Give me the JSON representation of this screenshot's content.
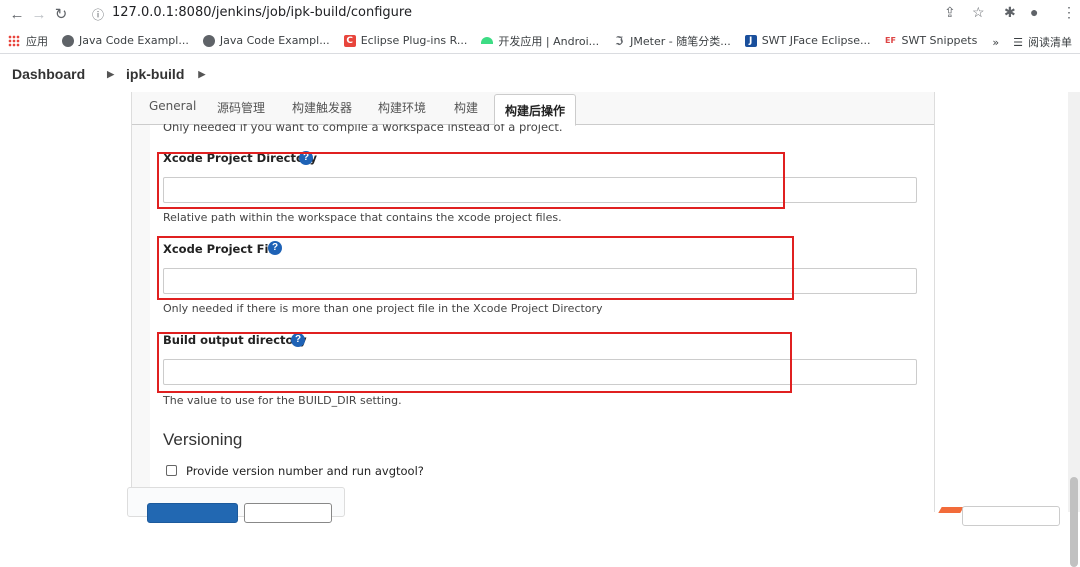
{
  "browser": {
    "url_host": "127.0.0.1",
    "url_path": ":8080/jenkins/job/ipk-build/configure",
    "bookmarks": [
      {
        "label": "应用",
        "icon": "apps-grid-icon",
        "color": "#e8453c"
      },
      {
        "label": "Java Code Exampl...",
        "icon": "globe-icon",
        "color": "#5f6368"
      },
      {
        "label": "Java Code Exampl...",
        "icon": "globe-icon",
        "color": "#5f6368"
      },
      {
        "label": "Eclipse Plug-ins R...",
        "icon": "c-logo-icon",
        "color": "#e8453c"
      },
      {
        "label": "开发应用 | Androi...",
        "icon": "android-icon",
        "color": "#3ddc84"
      },
      {
        "label": "JMeter - 随笔分类...",
        "icon": "jmeter-icon",
        "color": "#5f6368"
      },
      {
        "label": "SWT JFace Eclipse...",
        "icon": "swt-icon",
        "color": "#1a4f9c"
      },
      {
        "label": "SWT Snippets",
        "icon": "ef-icon",
        "color": "#d44"
      }
    ],
    "overflow": "»",
    "reading_list": "阅读清单"
  },
  "breadcrumb": {
    "root": "Dashboard",
    "job": "ipk-build"
  },
  "tabs": [
    {
      "label": "General"
    },
    {
      "label": "源码管理"
    },
    {
      "label": "构建触发器"
    },
    {
      "label": "构建环境"
    },
    {
      "label": "构建"
    },
    {
      "label": "构建后操作",
      "active": true
    }
  ],
  "form": {
    "cut_text": "Only needed if you want to compile a workspace instead of a project.",
    "fields": [
      {
        "label": "Xcode Project Directory",
        "help": "?",
        "value": "",
        "description": "Relative path within the workspace that contains the xcode project files."
      },
      {
        "label": "Xcode Project File",
        "help": "?",
        "value": "",
        "description": "Only needed if there is more than one project file in the Xcode Project Directory"
      },
      {
        "label": "Build output directory",
        "help": "?",
        "value": "",
        "description": "The value to use for the BUILD_DIR setting."
      }
    ],
    "versioning": {
      "title": "Versioning",
      "checkbox_label": "Provide version number and run avgtool?",
      "checked": false
    }
  },
  "colors": {
    "highlight": "#e02020",
    "primary_button": "#2268b2",
    "help_icon": "#1e62b6"
  }
}
